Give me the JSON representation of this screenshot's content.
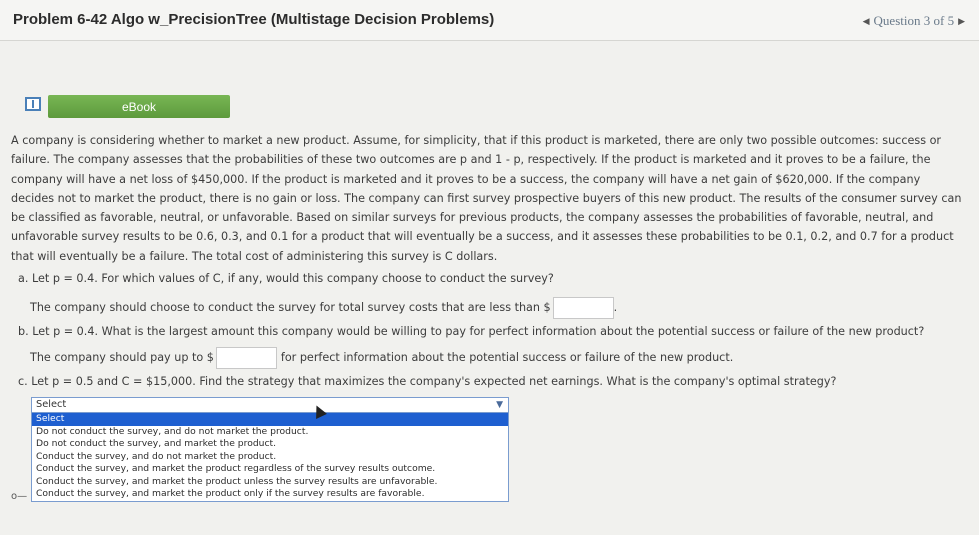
{
  "header": {
    "title": "Problem 6-42 Algo w_PrecisionTree (Multistage Decision Problems)",
    "question_nav": "Question 3 of 5"
  },
  "ebook": {
    "label": "eBook"
  },
  "problem": {
    "lines": [
      "A company is considering whether to market a new product. Assume, for simplicity, that if this product is marketed, there are only two possible outcomes: success or",
      "failure. The company assesses that the probabilities of these two outcomes are p and 1 - p, respectively. If the product is marketed and it proves to be a failure, the",
      "company will have a net loss of $450,000. If the product is marketed and it proves to be a success, the company will have a net gain of $620,000. If the company",
      "decides not to market the product, there is no gain or loss. The company can first survey prospective buyers of this new product. The results of the consumer survey can",
      "be classified as favorable, neutral, or unfavorable. Based on similar surveys for previous products, the company assesses the probabilities of favorable, neutral, and",
      "unfavorable survey results to be 0.6, 0.3, and 0.1 for a product that will eventually be a success, and it assesses these probabilities to be 0.1, 0.2, and 0.7 for a product",
      "that will eventually be a failure. The total cost of administering this survey is C dollars."
    ]
  },
  "part_a": {
    "question": "a. Let p = 0.4. For which values of C, if any, would this company choose to conduct the survey?",
    "answer_prefix": "The company should choose to conduct the survey for total survey costs that are less than $",
    "answer_value": "",
    "answer_suffix": "."
  },
  "part_b": {
    "question": "b. Let p = 0.4. What is the largest amount this company would be willing to pay for perfect information about the potential success or failure of the new product?",
    "answer_prefix": "The company should pay up to $",
    "answer_value": "",
    "answer_suffix": "for perfect information about the potential success or failure of the new product."
  },
  "part_c": {
    "question": "c. Let p = 0.5 and C = $15,000. Find the strategy that maximizes the company's expected net earnings. What is the company's optimal strategy?",
    "dropdown_selected": "Select",
    "options": [
      "Select",
      "Do not conduct the survey, and do not market the product.",
      "Do not conduct the survey, and market the product.",
      "Conduct the survey, and do not market the product.",
      "Conduct the survey, and market the product regardless of the survey results outcome.",
      "Conduct the survey, and market the product unless the survey results are unfavorable.",
      "Conduct the survey, and market the product only if the survey results are favorable."
    ],
    "highlighted_index": 0
  },
  "colors": {
    "ebook_green": "#5d9a3c",
    "highlight_blue": "#1e5fd0",
    "dropdown_border": "#7a9ccf"
  }
}
